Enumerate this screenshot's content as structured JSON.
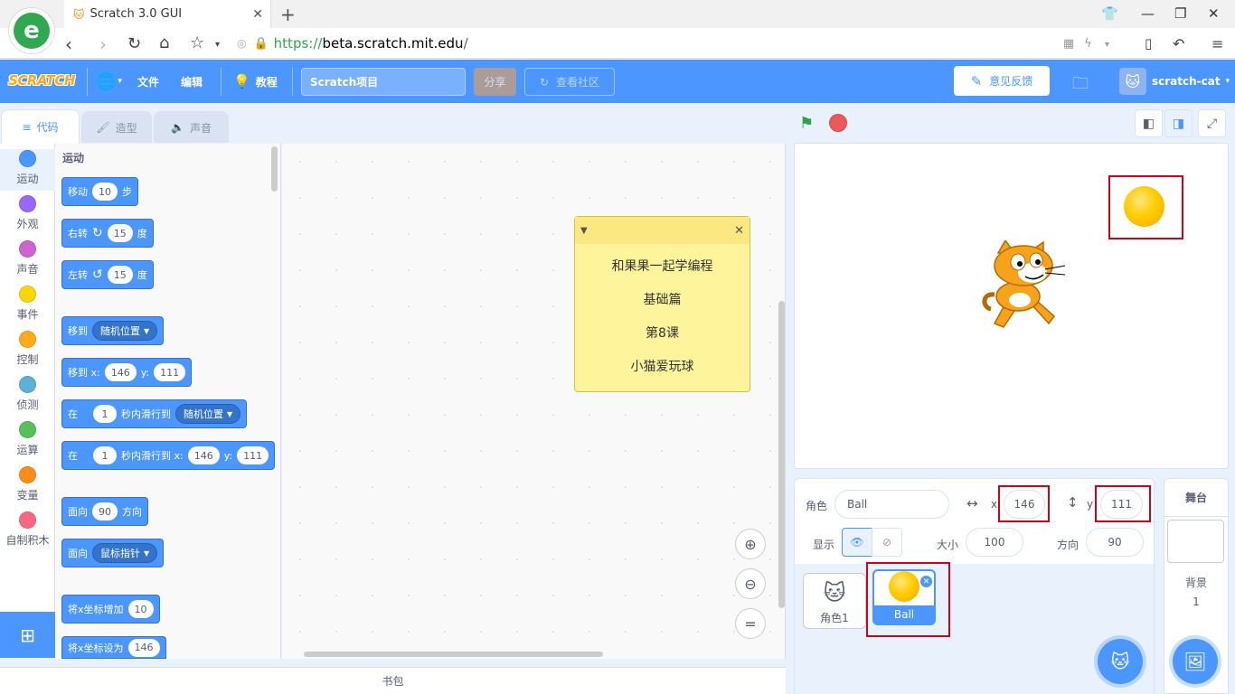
{
  "browser": {
    "tab_title": "Scratch 3.0 GUI",
    "url_protocol": "https://",
    "url_host": "beta.scratch.mit.edu",
    "url_path": "/",
    "logo_letter": "e"
  },
  "menubar": {
    "logo": "SCRATCH",
    "file": "文件",
    "edit": "编辑",
    "tutorials": "教程",
    "project_title": "Scratch项目",
    "share": "分享",
    "community": "查看社区",
    "feedback": "意见反馈",
    "username": "scratch-cat"
  },
  "tabs": {
    "code": "代码",
    "costumes": "造型",
    "sounds": "声音"
  },
  "categories": [
    {
      "label": "运动",
      "color": "#4c97ff"
    },
    {
      "label": "外观",
      "color": "#9966ff"
    },
    {
      "label": "声音",
      "color": "#cf63cf"
    },
    {
      "label": "事件",
      "color": "#ffd500"
    },
    {
      "label": "控制",
      "color": "#ffab19"
    },
    {
      "label": "侦测",
      "color": "#5cb1d6"
    },
    {
      "label": "运算",
      "color": "#59c059"
    },
    {
      "label": "变量",
      "color": "#ff8c1a"
    },
    {
      "label": "自制积木",
      "color": "#ff6680"
    }
  ],
  "palette": {
    "heading": "运动",
    "move": {
      "pre": "移动",
      "val": "10",
      "post": "步"
    },
    "turn_right": {
      "pre": "右转",
      "val": "15",
      "post": "度"
    },
    "turn_left": {
      "pre": "左转",
      "val": "15",
      "post": "度"
    },
    "goto": {
      "pre": "移到",
      "dd": "随机位置"
    },
    "goto_xy": {
      "pre": "移到 x:",
      "x": "146",
      "ylbl": "y:",
      "y": "111"
    },
    "glide": {
      "pre": "在",
      "val": "1",
      "mid": "秒内滑行到",
      "dd": "随机位置"
    },
    "glide_xy": {
      "pre": "在",
      "val": "1",
      "mid": "秒内滑行到 x:",
      "x": "146",
      "ylbl": "y:",
      "y": "111"
    },
    "point_dir": {
      "pre": "面向",
      "val": "90",
      "post": "方向"
    },
    "point_towards": {
      "pre": "面向",
      "dd": "鼠标指针"
    },
    "change_x": {
      "pre": "将x坐标增加",
      "val": "10"
    },
    "set_x": {
      "pre": "将x坐标设为",
      "val": "146"
    }
  },
  "note": {
    "lines": [
      "和果果一起学编程",
      "基础篇",
      "第8课",
      "小猫爱玩球"
    ]
  },
  "workspace": {
    "zoom_reset": "="
  },
  "backpack": "书包",
  "sprite_info": {
    "sprite_label": "角色",
    "sprite_name": "Ball",
    "x_label": "x",
    "x": "146",
    "y_label": "y",
    "y": "111",
    "show_label": "显示",
    "size_label": "大小",
    "size": "100",
    "direction_label": "方向",
    "direction": "90"
  },
  "sprites": [
    {
      "name": "角色1"
    },
    {
      "name": "Ball"
    }
  ],
  "stage_panel": {
    "title": "舞台",
    "backdrops_label": "背景",
    "backdrops_count": "1"
  }
}
